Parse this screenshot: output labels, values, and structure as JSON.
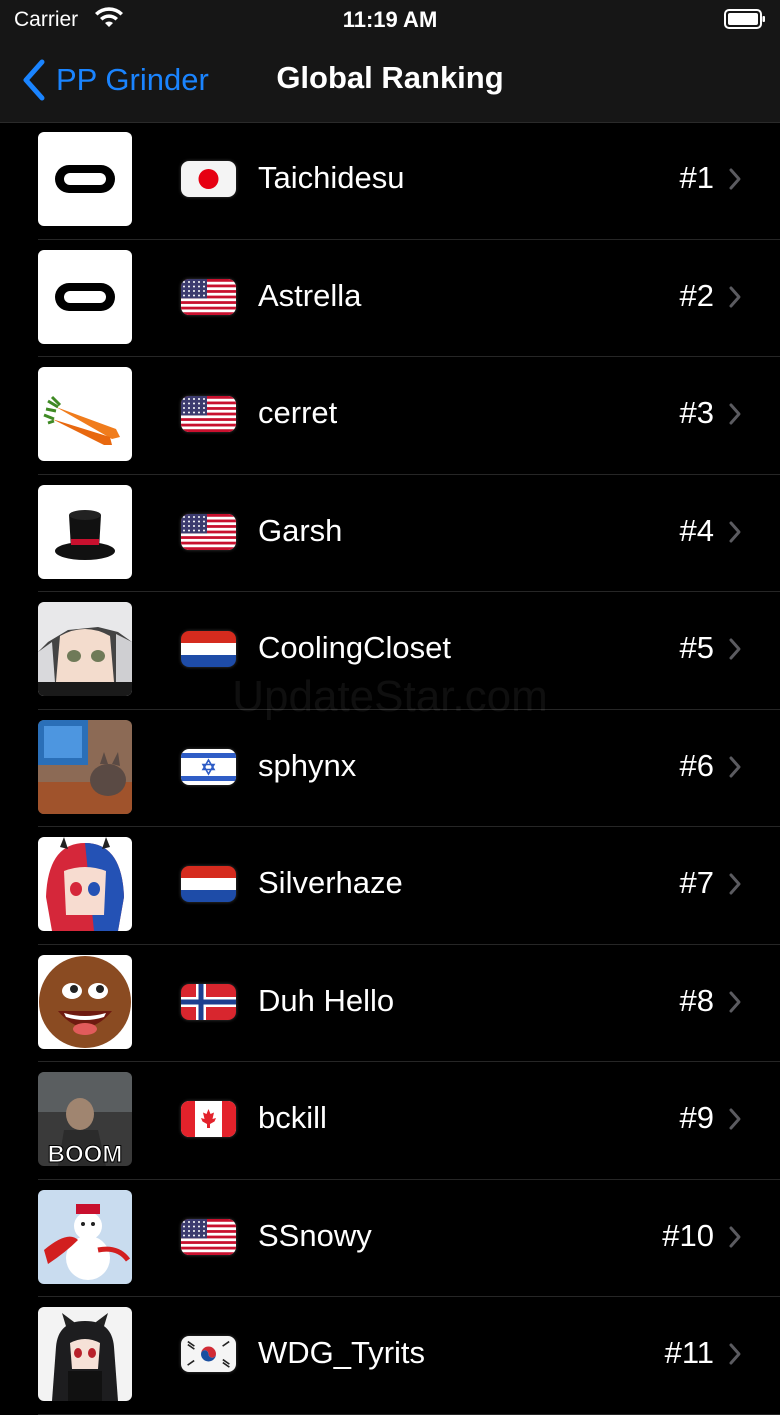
{
  "status_bar": {
    "carrier": "Carrier",
    "time": "11:19 AM"
  },
  "nav": {
    "back_label": "PP Grinder",
    "title": "Global Ranking"
  },
  "watermark": "UpdateStar.com",
  "rows": [
    {
      "name": "Taichidesu",
      "rank": "#1",
      "flag": "japan",
      "avatar": "oculus-logo"
    },
    {
      "name": "Astrella",
      "rank": "#2",
      "flag": "united-states",
      "avatar": "oculus-logo"
    },
    {
      "name": "cerret",
      "rank": "#3",
      "flag": "united-states",
      "avatar": "carrots"
    },
    {
      "name": "Garsh",
      "rank": "#4",
      "flag": "united-states",
      "avatar": "top-hat"
    },
    {
      "name": "CoolingCloset",
      "rank": "#5",
      "flag": "netherlands",
      "avatar": "anime-girl-white-hair"
    },
    {
      "name": "sphynx",
      "rank": "#6",
      "flag": "israel",
      "avatar": "sphynx-cat"
    },
    {
      "name": "Silverhaze",
      "rank": "#7",
      "flag": "netherlands",
      "avatar": "anime-girl-red-blue-hair"
    },
    {
      "name": "Duh Hello",
      "rank": "#8",
      "flag": "norway",
      "avatar": "laughing-face"
    },
    {
      "name": "bckill",
      "rank": "#9",
      "flag": "canada",
      "avatar": "boom-photo",
      "avatar_text": "BOOM"
    },
    {
      "name": "SSnowy",
      "rank": "#10",
      "flag": "united-states",
      "avatar": "snowman"
    },
    {
      "name": "WDG_Tyrits",
      "rank": "#11",
      "flag": "south-korea",
      "avatar": "anime-cat-girl"
    }
  ]
}
